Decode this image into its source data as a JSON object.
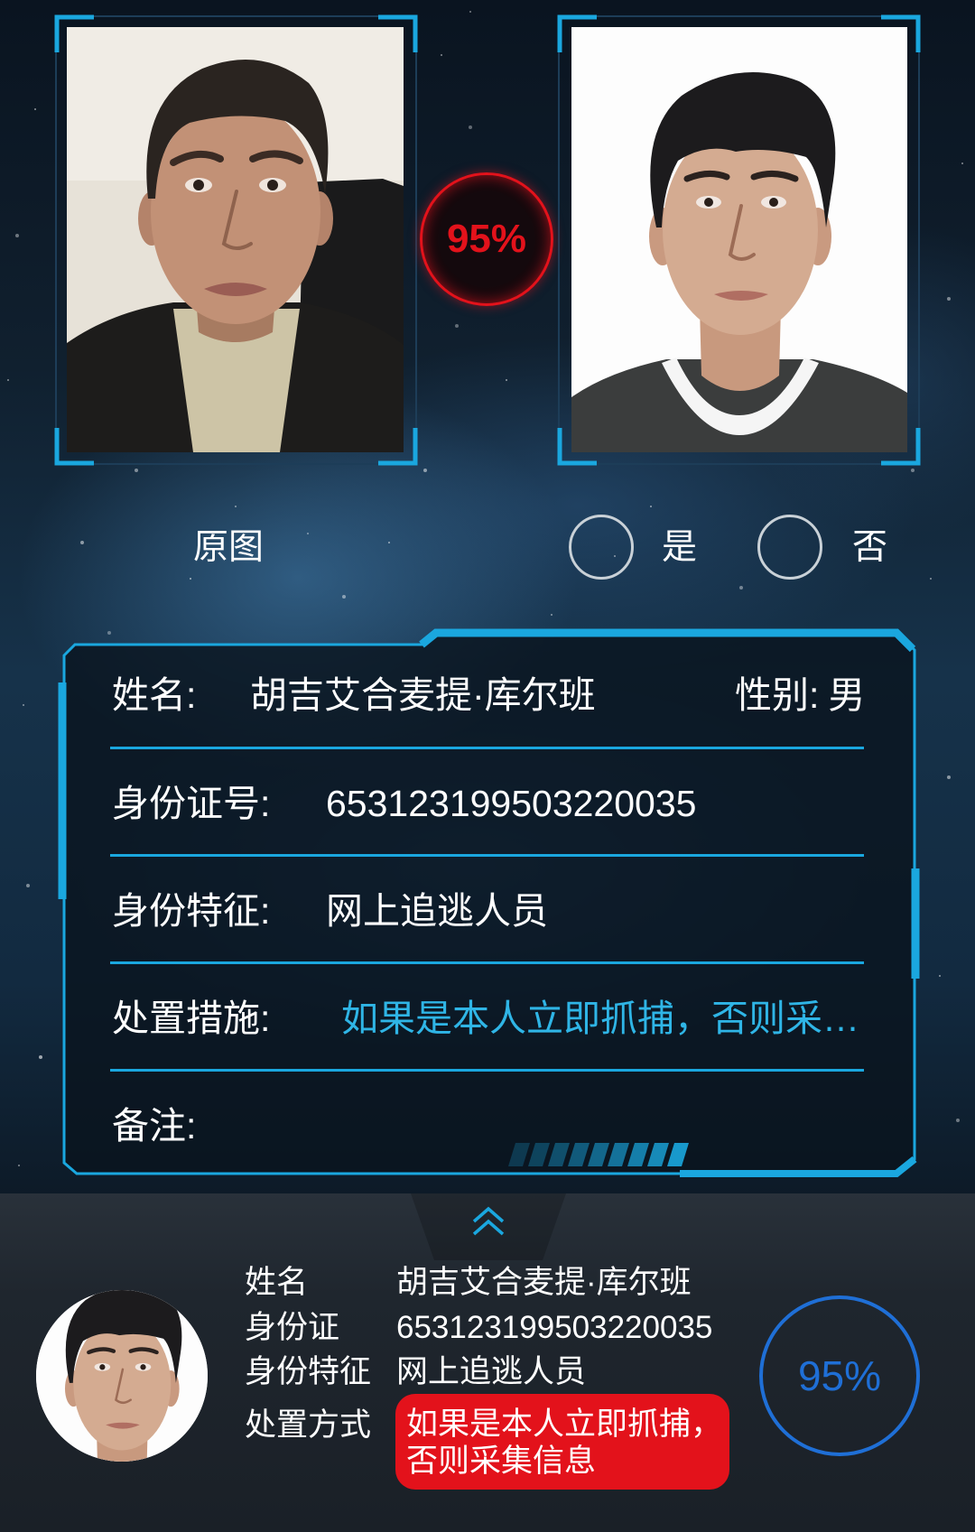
{
  "theme": {
    "accent": "#1aa7df",
    "alert_red": "#e3121b",
    "score_blue": "#1f6fd6",
    "measure_text": "#2fb5e6"
  },
  "comparison": {
    "match_score": "95%",
    "original_label": "原图",
    "yes_label": "是",
    "no_label": "否"
  },
  "info_panel": {
    "name_label": "姓名:",
    "name": "胡吉艾合麦提·库尔班",
    "gender_label": "性别:",
    "gender": "男",
    "id_label": "身份证号:",
    "id_number": "653123199503220035",
    "feature_label": "身份特征:",
    "feature": "网上追逃人员",
    "measure_label": "处置措施:",
    "measure": "如果是本人立即抓捕，否则采…",
    "remark_label": "备注:"
  },
  "bottom_card": {
    "expand_icon": "double-chevron-up-icon",
    "name_label": "姓名",
    "name": "胡吉艾合麦提·库尔班",
    "id_label": "身份证",
    "id_number": "653123199503220035",
    "feature_label": "身份特征",
    "feature": "网上追逃人员",
    "measure_label": "处置方式",
    "measure_lines": [
      "如果是本人立即抓捕，",
      "否则采集信息"
    ],
    "match_score": "95%"
  }
}
